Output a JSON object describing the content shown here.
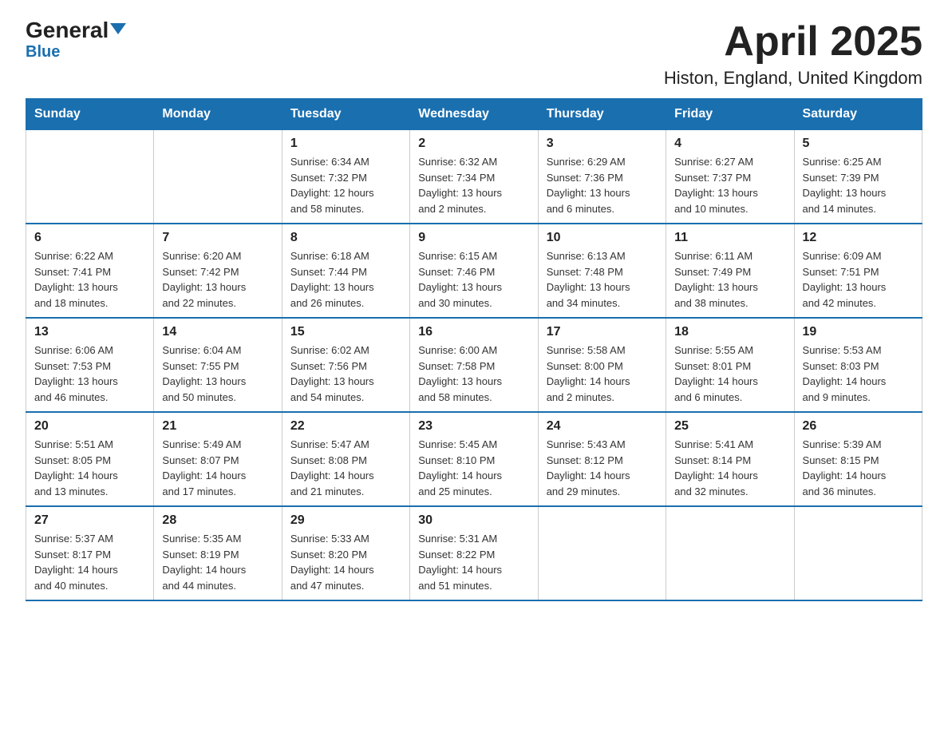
{
  "logo": {
    "name_part1": "General",
    "name_part2": "Blue"
  },
  "title": "April 2025",
  "subtitle": "Histon, England, United Kingdom",
  "weekdays": [
    "Sunday",
    "Monday",
    "Tuesday",
    "Wednesday",
    "Thursday",
    "Friday",
    "Saturday"
  ],
  "weeks": [
    [
      {
        "day": "",
        "info": ""
      },
      {
        "day": "",
        "info": ""
      },
      {
        "day": "1",
        "info": "Sunrise: 6:34 AM\nSunset: 7:32 PM\nDaylight: 12 hours\nand 58 minutes."
      },
      {
        "day": "2",
        "info": "Sunrise: 6:32 AM\nSunset: 7:34 PM\nDaylight: 13 hours\nand 2 minutes."
      },
      {
        "day": "3",
        "info": "Sunrise: 6:29 AM\nSunset: 7:36 PM\nDaylight: 13 hours\nand 6 minutes."
      },
      {
        "day": "4",
        "info": "Sunrise: 6:27 AM\nSunset: 7:37 PM\nDaylight: 13 hours\nand 10 minutes."
      },
      {
        "day": "5",
        "info": "Sunrise: 6:25 AM\nSunset: 7:39 PM\nDaylight: 13 hours\nand 14 minutes."
      }
    ],
    [
      {
        "day": "6",
        "info": "Sunrise: 6:22 AM\nSunset: 7:41 PM\nDaylight: 13 hours\nand 18 minutes."
      },
      {
        "day": "7",
        "info": "Sunrise: 6:20 AM\nSunset: 7:42 PM\nDaylight: 13 hours\nand 22 minutes."
      },
      {
        "day": "8",
        "info": "Sunrise: 6:18 AM\nSunset: 7:44 PM\nDaylight: 13 hours\nand 26 minutes."
      },
      {
        "day": "9",
        "info": "Sunrise: 6:15 AM\nSunset: 7:46 PM\nDaylight: 13 hours\nand 30 minutes."
      },
      {
        "day": "10",
        "info": "Sunrise: 6:13 AM\nSunset: 7:48 PM\nDaylight: 13 hours\nand 34 minutes."
      },
      {
        "day": "11",
        "info": "Sunrise: 6:11 AM\nSunset: 7:49 PM\nDaylight: 13 hours\nand 38 minutes."
      },
      {
        "day": "12",
        "info": "Sunrise: 6:09 AM\nSunset: 7:51 PM\nDaylight: 13 hours\nand 42 minutes."
      }
    ],
    [
      {
        "day": "13",
        "info": "Sunrise: 6:06 AM\nSunset: 7:53 PM\nDaylight: 13 hours\nand 46 minutes."
      },
      {
        "day": "14",
        "info": "Sunrise: 6:04 AM\nSunset: 7:55 PM\nDaylight: 13 hours\nand 50 minutes."
      },
      {
        "day": "15",
        "info": "Sunrise: 6:02 AM\nSunset: 7:56 PM\nDaylight: 13 hours\nand 54 minutes."
      },
      {
        "day": "16",
        "info": "Sunrise: 6:00 AM\nSunset: 7:58 PM\nDaylight: 13 hours\nand 58 minutes."
      },
      {
        "day": "17",
        "info": "Sunrise: 5:58 AM\nSunset: 8:00 PM\nDaylight: 14 hours\nand 2 minutes."
      },
      {
        "day": "18",
        "info": "Sunrise: 5:55 AM\nSunset: 8:01 PM\nDaylight: 14 hours\nand 6 minutes."
      },
      {
        "day": "19",
        "info": "Sunrise: 5:53 AM\nSunset: 8:03 PM\nDaylight: 14 hours\nand 9 minutes."
      }
    ],
    [
      {
        "day": "20",
        "info": "Sunrise: 5:51 AM\nSunset: 8:05 PM\nDaylight: 14 hours\nand 13 minutes."
      },
      {
        "day": "21",
        "info": "Sunrise: 5:49 AM\nSunset: 8:07 PM\nDaylight: 14 hours\nand 17 minutes."
      },
      {
        "day": "22",
        "info": "Sunrise: 5:47 AM\nSunset: 8:08 PM\nDaylight: 14 hours\nand 21 minutes."
      },
      {
        "day": "23",
        "info": "Sunrise: 5:45 AM\nSunset: 8:10 PM\nDaylight: 14 hours\nand 25 minutes."
      },
      {
        "day": "24",
        "info": "Sunrise: 5:43 AM\nSunset: 8:12 PM\nDaylight: 14 hours\nand 29 minutes."
      },
      {
        "day": "25",
        "info": "Sunrise: 5:41 AM\nSunset: 8:14 PM\nDaylight: 14 hours\nand 32 minutes."
      },
      {
        "day": "26",
        "info": "Sunrise: 5:39 AM\nSunset: 8:15 PM\nDaylight: 14 hours\nand 36 minutes."
      }
    ],
    [
      {
        "day": "27",
        "info": "Sunrise: 5:37 AM\nSunset: 8:17 PM\nDaylight: 14 hours\nand 40 minutes."
      },
      {
        "day": "28",
        "info": "Sunrise: 5:35 AM\nSunset: 8:19 PM\nDaylight: 14 hours\nand 44 minutes."
      },
      {
        "day": "29",
        "info": "Sunrise: 5:33 AM\nSunset: 8:20 PM\nDaylight: 14 hours\nand 47 minutes."
      },
      {
        "day": "30",
        "info": "Sunrise: 5:31 AM\nSunset: 8:22 PM\nDaylight: 14 hours\nand 51 minutes."
      },
      {
        "day": "",
        "info": ""
      },
      {
        "day": "",
        "info": ""
      },
      {
        "day": "",
        "info": ""
      }
    ]
  ]
}
